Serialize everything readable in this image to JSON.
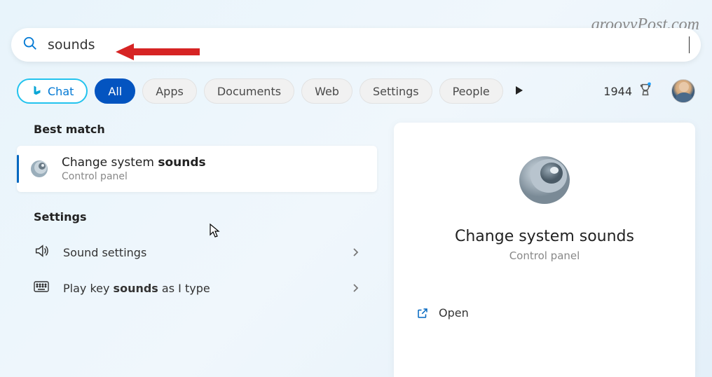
{
  "watermark": "groovyPost.com",
  "search": {
    "query": "sounds"
  },
  "filters": {
    "chat": "Chat",
    "tabs": [
      "All",
      "Apps",
      "Documents",
      "Web",
      "Settings",
      "People"
    ],
    "active_index": 0
  },
  "points": {
    "value": "1944"
  },
  "left": {
    "best_match_label": "Best match",
    "result": {
      "title_plain": "Change system ",
      "title_bold": "sounds",
      "subtitle": "Control panel"
    },
    "settings_label": "Settings",
    "settings_items": [
      {
        "icon": "speaker",
        "pre": "Sound settings",
        "bold": "",
        "post": ""
      },
      {
        "icon": "keyboard",
        "pre": "Play key ",
        "bold": "sounds",
        "post": " as I type"
      }
    ]
  },
  "preview": {
    "title": "Change system sounds",
    "subtitle": "Control panel",
    "open_label": "Open"
  }
}
